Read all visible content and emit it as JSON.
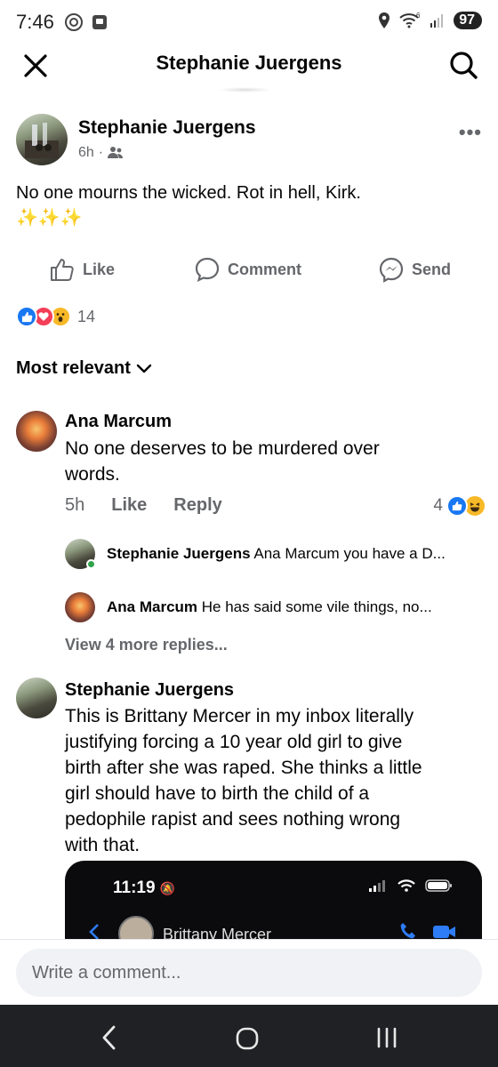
{
  "status": {
    "time": "7:46",
    "battery": "97",
    "wifi_sup": "6"
  },
  "header": {
    "title": "Stephanie Juergens"
  },
  "post": {
    "author": "Stephanie Juergens",
    "time": "6h",
    "text_line1": "No one mourns the wicked. Rot in hell, Kirk.",
    "text_line2": "✨✨✨",
    "actions": {
      "like": "Like",
      "comment": "Comment",
      "send": "Send"
    },
    "reaction_count": "14"
  },
  "sort_label": "Most relevant",
  "comments": [
    {
      "author": "Ana Marcum",
      "text_line1": "No one deserves to be murdered over",
      "text_line2": "words.",
      "time": "5h",
      "like": "Like",
      "reply": "Reply",
      "reaction_count": "4"
    },
    {
      "author": "Stephanie Juergens",
      "text_lines": [
        "This is Brittany Mercer in my inbox literally",
        "justifying forcing a 10 year old girl to give",
        "birth after she was raped. She thinks a little",
        "girl should have to birth the child of a",
        "pedophile rapist and sees nothing wrong",
        "with that."
      ]
    }
  ],
  "replies": [
    {
      "author": "Stephanie Juergens",
      "text": "Ana Marcum you have a D..."
    },
    {
      "author": "Ana Marcum",
      "text": "He has said some vile things, no..."
    }
  ],
  "view_more": "View 4 more replies...",
  "embed": {
    "time": "11:19",
    "contact": "Brittany Mercer"
  },
  "composer": {
    "placeholder": "Write a comment..."
  },
  "colors": {
    "facebook_blue": "#1877f2",
    "love_red": "#f33e58",
    "secondary_text": "#65676b"
  }
}
